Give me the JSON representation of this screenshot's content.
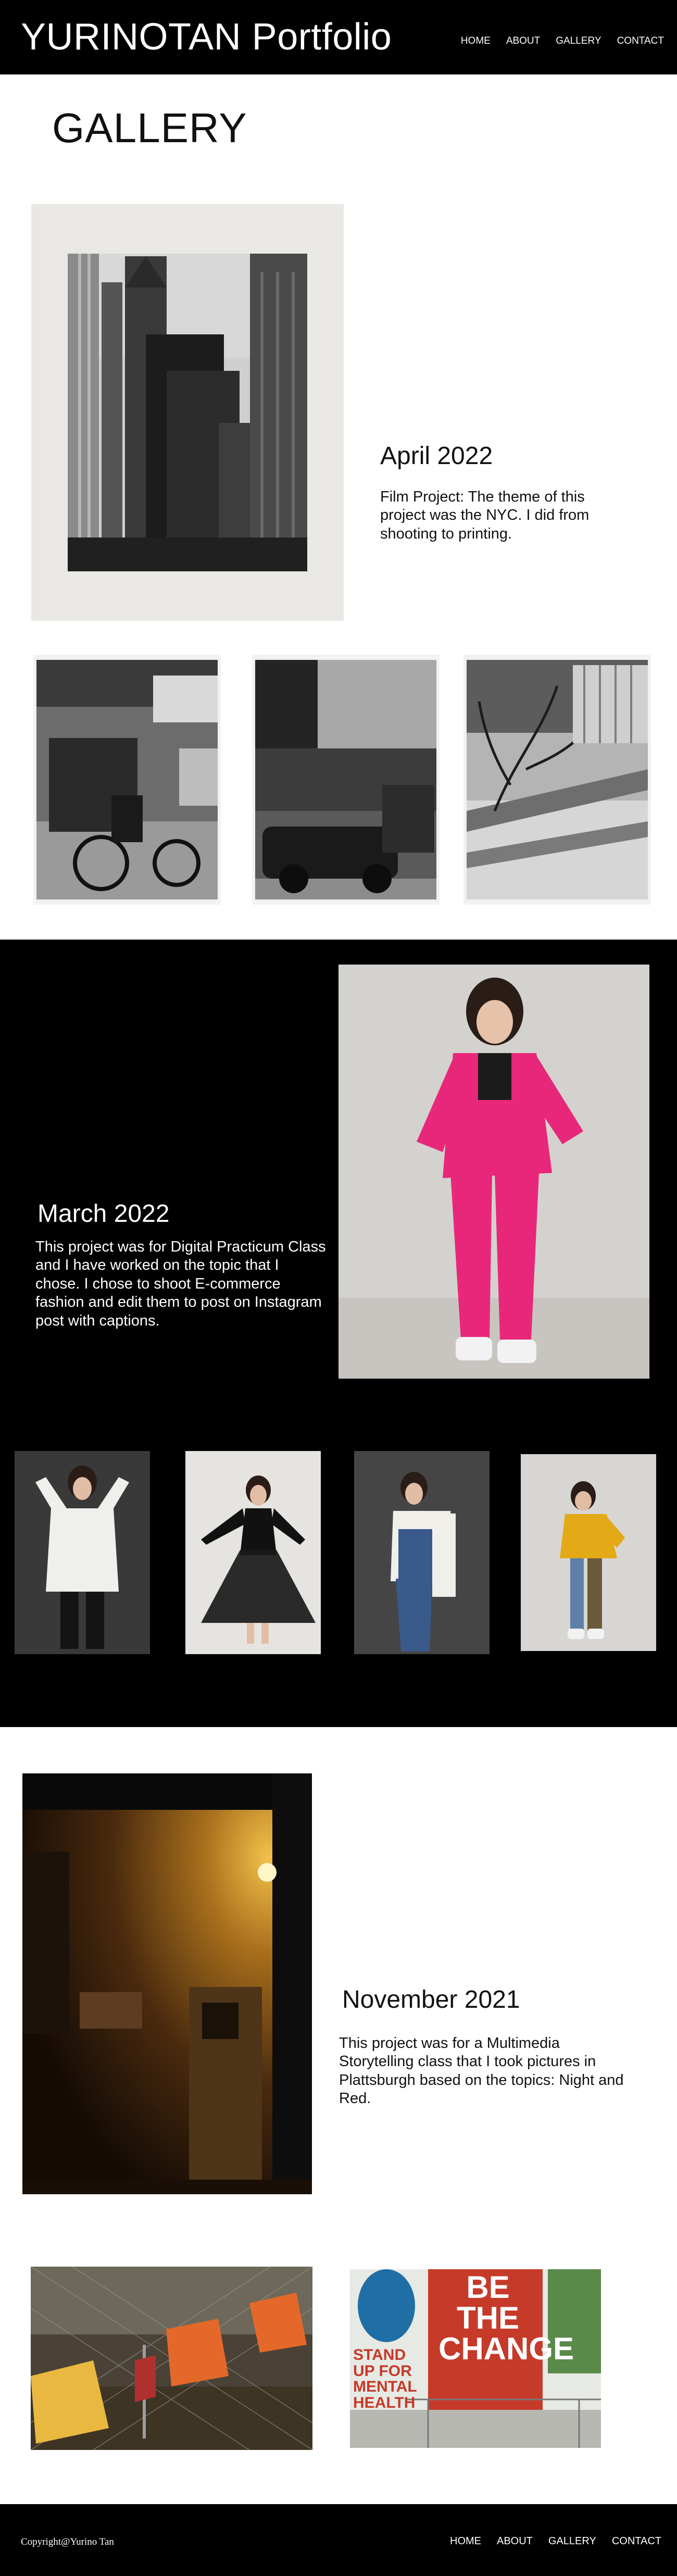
{
  "header": {
    "site_title": "YURINOTAN Portfolio",
    "nav": [
      "HOME",
      "ABOUT",
      "GALLERY",
      "CONTACT"
    ]
  },
  "gallery": {
    "title": "GALLERY"
  },
  "sections": [
    {
      "date": "April 2022",
      "description": "Film Project: The theme of this project was the NYC. I did from shooting to printing."
    },
    {
      "date": "March 2022",
      "description": "This project was for Digital Practicum Class and I have worked on the topic that I chose. I chose to shoot E-commerce fashion and edit them to post on Instagram post with captions."
    },
    {
      "date": "November 2021",
      "description": "This project was for a Multimedia Storytelling class that I took pictures in Plattsburgh based on the topics: Night and Red."
    }
  ],
  "photos": {
    "sign_text": [
      "BE",
      "THE",
      "CHANGE"
    ],
    "stand_text": [
      "STAND",
      "UP FOR",
      "MENTAL",
      "HEALTH"
    ]
  },
  "colors": {
    "header_bg": "#000000",
    "band_bg": "#000000",
    "accent_pink": "#e8277a"
  },
  "footer": {
    "copyright": "Copyright@Yurino Tan",
    "nav": [
      "HOME",
      "ABOUT",
      "GALLERY",
      "CONTACT"
    ]
  }
}
